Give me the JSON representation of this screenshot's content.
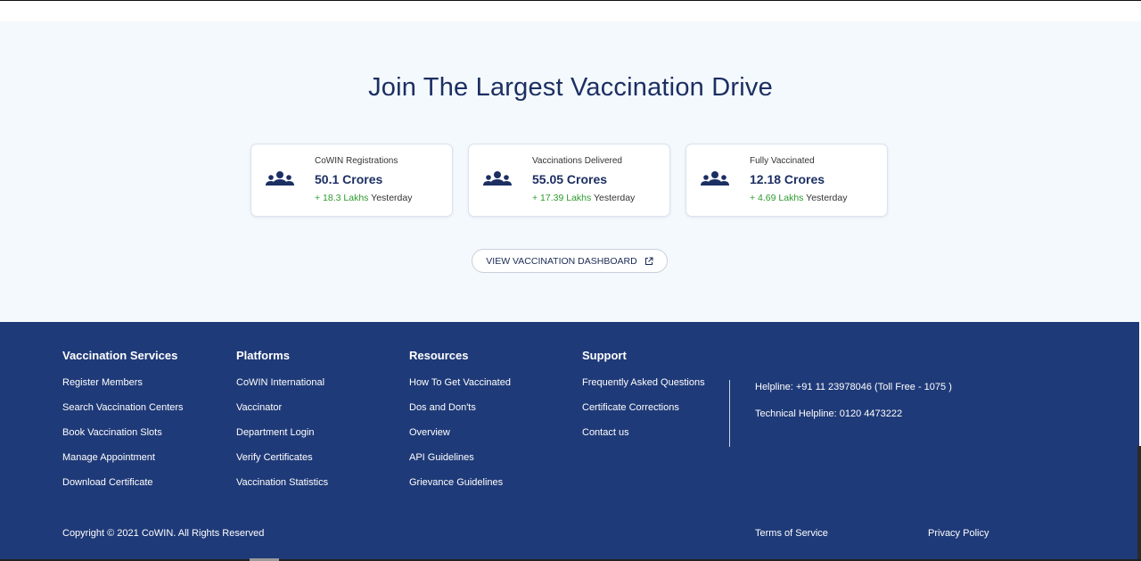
{
  "hero": {
    "title": "Join The Largest Vaccination Drive",
    "stats": [
      {
        "label": "CoWIN Registrations",
        "value": "50.1 Crores",
        "delta_value": "+ 18.3 Lakhs",
        "delta_suffix": " Yesterday"
      },
      {
        "label": "Vaccinations Delivered",
        "value": "55.05 Crores",
        "delta_value": "+ 17.39 Lakhs",
        "delta_suffix": " Yesterday"
      },
      {
        "label": "Fully Vaccinated",
        "value": "12.18 Crores",
        "delta_value": "+ 4.69 Lakhs",
        "delta_suffix": " Yesterday"
      }
    ],
    "dashboard_button": "VIEW VACCINATION DASHBOARD"
  },
  "footer": {
    "columns": [
      {
        "title": "Vaccination Services",
        "links": [
          "Register Members",
          "Search Vaccination Centers",
          "Book Vaccination Slots",
          "Manage Appointment",
          "Download Certificate"
        ]
      },
      {
        "title": "Platforms",
        "links": [
          "CoWIN International",
          "Vaccinator",
          "Department Login",
          "Verify Certificates",
          "Vaccination Statistics"
        ]
      },
      {
        "title": "Resources",
        "links": [
          "How To Get Vaccinated",
          "Dos and Don'ts",
          "Overview",
          "API Guidelines",
          "Grievance Guidelines"
        ]
      },
      {
        "title": "Support",
        "links": [
          "Frequently Asked Questions",
          "Certificate Corrections",
          "Contact us"
        ]
      }
    ],
    "helpline": "Helpline: +91 11 23978046 (Toll Free - 1075 )",
    "technical_helpline": "Technical Helpline: 0120 4473222",
    "copyright": "Copyright © 2021 CoWIN. All Rights Reserved",
    "terms": "Terms of Service",
    "privacy": "Privacy Policy"
  },
  "colors": {
    "navy": "#1f3a78",
    "title": "#1c2f63",
    "positive": "#2e9a2e",
    "hero_bg": "#f4f9fd"
  },
  "icons": {
    "stat_icon": "people-group-icon",
    "button_icon": "external-link-icon"
  }
}
